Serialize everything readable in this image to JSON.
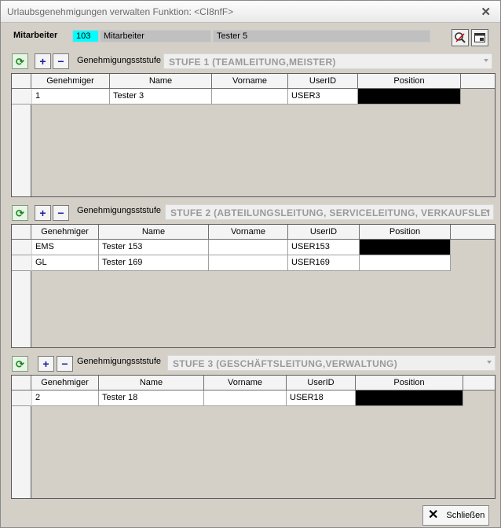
{
  "window": {
    "title": "Urlaubsgenehmigungen verwalten Funktion: <CI8nfF>"
  },
  "employee": {
    "label": "Mitarbeiter",
    "id": "103",
    "field_label": "Mitarbeiter",
    "name": "Tester 5"
  },
  "levels": [
    {
      "level_label": "Genehmigungsststufe",
      "selected": "STUFE 1 (TEAMLEITUNG,MEISTER)",
      "columns": [
        "Genehmiger",
        "Name",
        "Vorname",
        "UserID",
        "Position"
      ],
      "rows": [
        [
          "1",
          "Tester 3",
          "",
          "USER3",
          ""
        ]
      ]
    },
    {
      "level_label": "Genehmigungsststufe",
      "selected": "STUFE 2 (ABTEILUNGSLEITUNG, SERVICELEITUNG, VERKAUFSLEI",
      "columns": [
        "Genehmiger",
        "Name",
        "Vorname",
        "UserID",
        "Position"
      ],
      "rows": [
        [
          "EMS",
          "Tester 153",
          "",
          "USER153",
          ""
        ],
        [
          "GL",
          "Tester 169",
          "",
          "USER169",
          ""
        ]
      ]
    },
    {
      "level_label": "Genehmigungsststufe",
      "selected": "STUFE 3 (GESCHÄFTSLEITUNG,VERWALTUNG)",
      "columns": [
        "Genehmiger",
        "Name",
        "Vorname",
        "UserID",
        "Position"
      ],
      "rows": [
        [
          "2",
          "Tester 18",
          "",
          "USER18",
          ""
        ]
      ]
    }
  ],
  "buttons": {
    "add": "+",
    "remove": "−",
    "refresh": "⟳",
    "close_label": "Schließen",
    "close_icon": "✕"
  }
}
